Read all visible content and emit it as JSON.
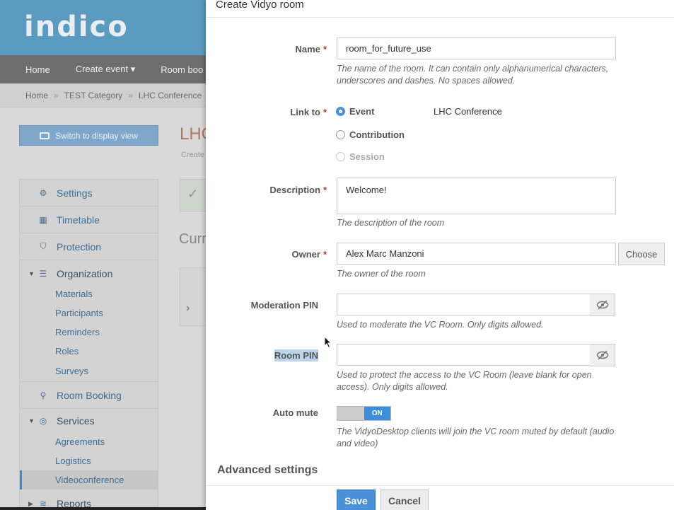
{
  "background": {
    "logo_text": "indico",
    "menu": [
      "Home",
      "Create event ▾",
      "Room boo"
    ],
    "breadcrumb": [
      "Home",
      "TEST Category",
      "LHC Conference"
    ],
    "breadcrumb_sep": "»",
    "display_button": "Switch to display view",
    "event_title": "LHC",
    "event_sub": "Create",
    "current_heading": "Curr",
    "sidebar": {
      "settings": "Settings",
      "timetable": "Timetable",
      "protection": "Protection",
      "organization": "Organization",
      "materials": "Materials",
      "participants": "Participants",
      "reminders": "Reminders",
      "roles": "Roles",
      "surveys": "Surveys",
      "room_booking": "Room Booking",
      "services": "Services",
      "agreements": "Agreements",
      "logistics": "Logistics",
      "videoconference": "Videoconference",
      "reports": "Reports"
    }
  },
  "dialog": {
    "title": "Create Vidyo room",
    "name": {
      "label": "Name",
      "value": "room_for_future_use",
      "hint": "The name of the room. It can contain only alphanumerical characters, underscores and dashes. No spaces allowed."
    },
    "link_to": {
      "label": "Link to",
      "options": [
        "Event",
        "Contribution",
        "Session"
      ],
      "selected": "Event",
      "value": "LHC Conference"
    },
    "description": {
      "label": "Description",
      "value": "Welcome!",
      "hint": "The description of the room"
    },
    "owner": {
      "label": "Owner",
      "value": "Alex Marc Manzoni",
      "choose_label": "Choose",
      "hint": "The owner of the room"
    },
    "moderation_pin": {
      "label": "Moderation PIN",
      "value": "",
      "hint": "Used to moderate the VC Room. Only digits allowed."
    },
    "room_pin": {
      "label": "Room PIN",
      "value": "",
      "hint": "Used to protect the access to the VC Room (leave blank for open access). Only digits allowed."
    },
    "auto_mute": {
      "label": "Auto mute",
      "state": "ON",
      "hint": "The VidyoDesktop clients will join the VC room muted by default (audio and video)"
    },
    "advanced_heading": "Advanced settings",
    "save_label": "Save",
    "cancel_label": "Cancel",
    "required_marker": "*"
  },
  "colors": {
    "primary": "#4a90d9",
    "required": "#c0392b",
    "header_bg": "#5b9bc0"
  }
}
